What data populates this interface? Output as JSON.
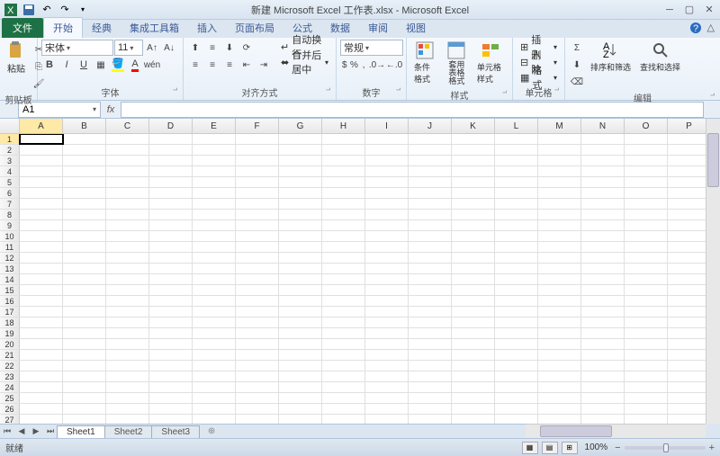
{
  "title": "新建 Microsoft Excel 工作表.xlsx - Microsoft Excel",
  "tabs": {
    "file": "文件",
    "home": "开始",
    "classic": "经典",
    "toolbox": "集成工具箱",
    "insert": "插入",
    "layout": "页面布局",
    "formulas": "公式",
    "data": "数据",
    "review": "审阅",
    "view": "视图"
  },
  "groups": {
    "clipboard": "剪贴板",
    "font": "字体",
    "alignment": "对齐方式",
    "number": "数字",
    "styles": "样式",
    "cells": "单元格",
    "editing": "编辑"
  },
  "ribbon": {
    "paste": "粘贴",
    "font_name": "宋体",
    "font_size": "11",
    "wrap": "自动换行",
    "merge": "合并后居中",
    "number_format": "常规",
    "cond_format": "条件格式",
    "table_format": "套用\n表格格式",
    "cell_styles": "单元格样式",
    "insert": "插入",
    "delete": "删除",
    "format": "格式",
    "sort_filter": "排序和筛选",
    "find_select": "查找和选择"
  },
  "namebox": "A1",
  "columns": [
    "A",
    "B",
    "C",
    "D",
    "E",
    "F",
    "G",
    "H",
    "I",
    "J",
    "K",
    "L",
    "M",
    "N",
    "O",
    "P"
  ],
  "rows_count": 29,
  "active_cell": {
    "row": 1,
    "col": "A"
  },
  "sheets": [
    "Sheet1",
    "Sheet2",
    "Sheet3"
  ],
  "status": "就绪",
  "zoom": "100%"
}
